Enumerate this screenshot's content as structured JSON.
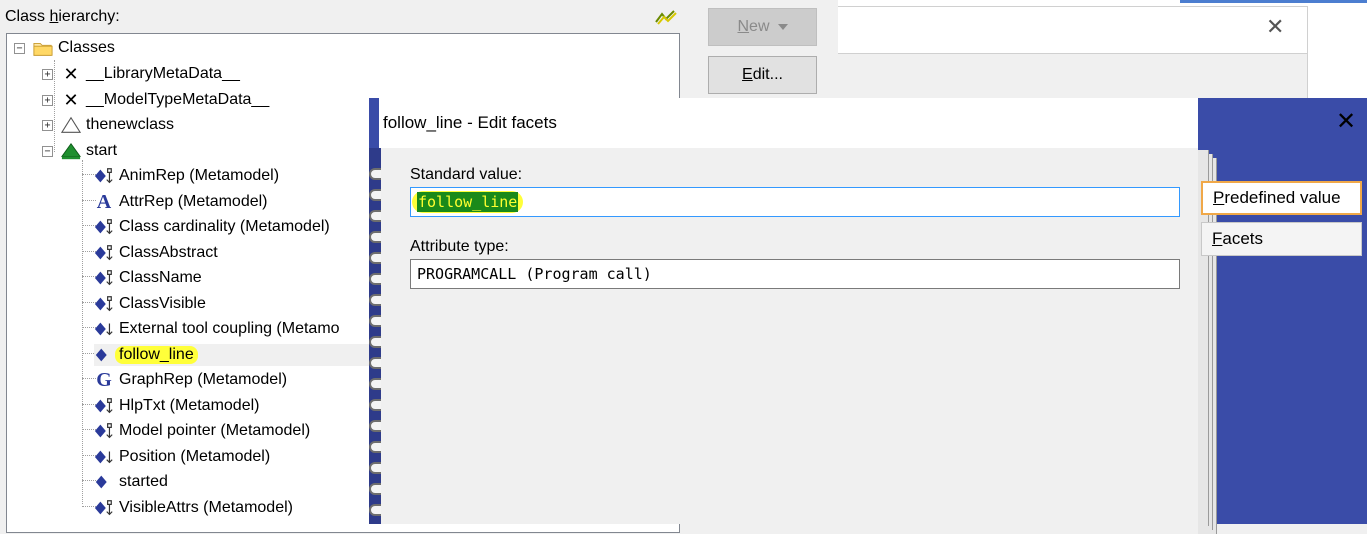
{
  "hierarchy": {
    "label_pre": "Class ",
    "label_access": "h",
    "label_post": "ierarchy:",
    "refresh_icon": "refresh-icon",
    "root": "Classes",
    "items": [
      {
        "label": "__LibraryMetaData__",
        "icon": "cross-icon",
        "expander": "+"
      },
      {
        "label": "__ModelTypeMetaData__",
        "icon": "cross-icon",
        "expander": "+"
      },
      {
        "label": "thenewclass",
        "icon": "triangle-outline-icon",
        "expander": "+"
      },
      {
        "label": "start",
        "icon": "green-triangle-icon",
        "expander": "−"
      }
    ],
    "children": [
      {
        "label": "AnimRep (Metamodel)",
        "icon": "diamond-gear-icon"
      },
      {
        "label": "AttrRep (Metamodel)",
        "icon": "letter-a-icon"
      },
      {
        "label": "Class cardinality (Metamodel)",
        "icon": "diamond-gear-icon"
      },
      {
        "label": "ClassAbstract",
        "icon": "diamond-gear-icon"
      },
      {
        "label": "ClassName",
        "icon": "diamond-gear-icon"
      },
      {
        "label": "ClassVisible",
        "icon": "diamond-gear-icon"
      },
      {
        "label": "External tool coupling (Metamo",
        "icon": "diamond-arrow-icon"
      },
      {
        "label": "follow_line",
        "icon": "diamond-icon"
      },
      {
        "label": "GraphRep (Metamodel)",
        "icon": "letter-g-icon"
      },
      {
        "label": "HlpTxt (Metamodel)",
        "icon": "diamond-gear-icon"
      },
      {
        "label": "Model pointer (Metamodel)",
        "icon": "diamond-gear-icon"
      },
      {
        "label": "Position (Metamodel)",
        "icon": "diamond-arrow-icon"
      },
      {
        "label": "started",
        "icon": "diamond-icon"
      },
      {
        "label": "VisibleAttrs (Metamodel)",
        "icon": "diamond-gear-icon"
      }
    ]
  },
  "buttons": {
    "new_access": "N",
    "new_rest": "ew",
    "edit_access": "E",
    "edit_rest": "dit..."
  },
  "dialog": {
    "title": "follow_line - Edit facets",
    "standard_value_label": "Standard value:",
    "standard_value": "follow_line",
    "attribute_type_label": "Attribute type:",
    "attribute_type": "PROGRAMCALL (Program call)",
    "tabs": [
      {
        "access": "P",
        "rest": "redefined value",
        "active": true
      },
      {
        "access": "F",
        "rest": "acets",
        "active": false
      }
    ]
  },
  "colors": {
    "dialog_frame": "#3a4ca8",
    "highlight": "#ffff3a",
    "selection": "#1a8a1a",
    "active_tab_border": "#f0a848"
  }
}
